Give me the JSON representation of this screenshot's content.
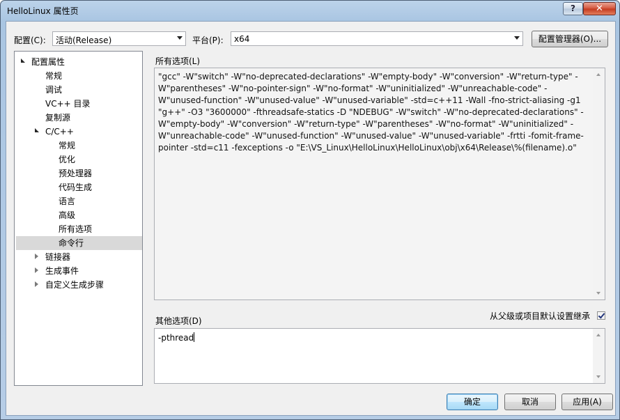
{
  "window": {
    "title": "HelloLinux 属性页"
  },
  "config": {
    "configuration_label": "配置(C):",
    "configuration_value": "活动(Release)",
    "platform_label": "平台(P):",
    "platform_value": "x64",
    "manager_button": "配置管理器(O)..."
  },
  "tree": {
    "root": "配置属性",
    "items": [
      "常规",
      "调试",
      "VC++ 目录",
      "复制源"
    ],
    "cpp": "C/C++",
    "cpp_children": [
      "常规",
      "优化",
      "预处理器",
      "代码生成",
      "语言",
      "高级",
      "所有选项",
      "命令行"
    ],
    "selected": "命令行",
    "collapsed": [
      "链接器",
      "生成事件",
      "自定义生成步骤"
    ]
  },
  "all_options": {
    "label": "所有选项(L)",
    "text": "\"gcc\" -W\"switch\" -W\"no-deprecated-declarations\" -W\"empty-body\" -W\"conversion\" -W\"return-type\" -W\"parentheses\" -W\"no-pointer-sign\" -W\"no-format\" -W\"uninitialized\" -W\"unreachable-code\" -W\"unused-function\" -W\"unused-value\" -W\"unused-variable\" -std=c++11 -Wall -fno-strict-aliasing -g1 \"g++\" -O3 \"3600000\" -fthreadsafe-statics -D \"NDEBUG\" -W\"switch\" -W\"no-deprecated-declarations\" -W\"empty-body\" -W\"conversion\" -W\"return-type\" -W\"parentheses\" -W\"no-format\" -W\"uninitialized\" -W\"unreachable-code\" -W\"unused-function\" -W\"unused-value\" -W\"unused-variable\" -frtti -fomit-frame-pointer -std=c11 -fexceptions -o \"E:\\VS_Linux\\HelloLinux\\HelloLinux\\obj\\x64\\Release\\%(filename).o\""
  },
  "other_options": {
    "label": "其他选项(D)",
    "value": "-pthread",
    "inherit_label": "从父级或项目默认设置继承",
    "inherit_checked": true
  },
  "buttons": {
    "ok": "确定",
    "cancel": "取消",
    "apply": "应用(A)"
  }
}
